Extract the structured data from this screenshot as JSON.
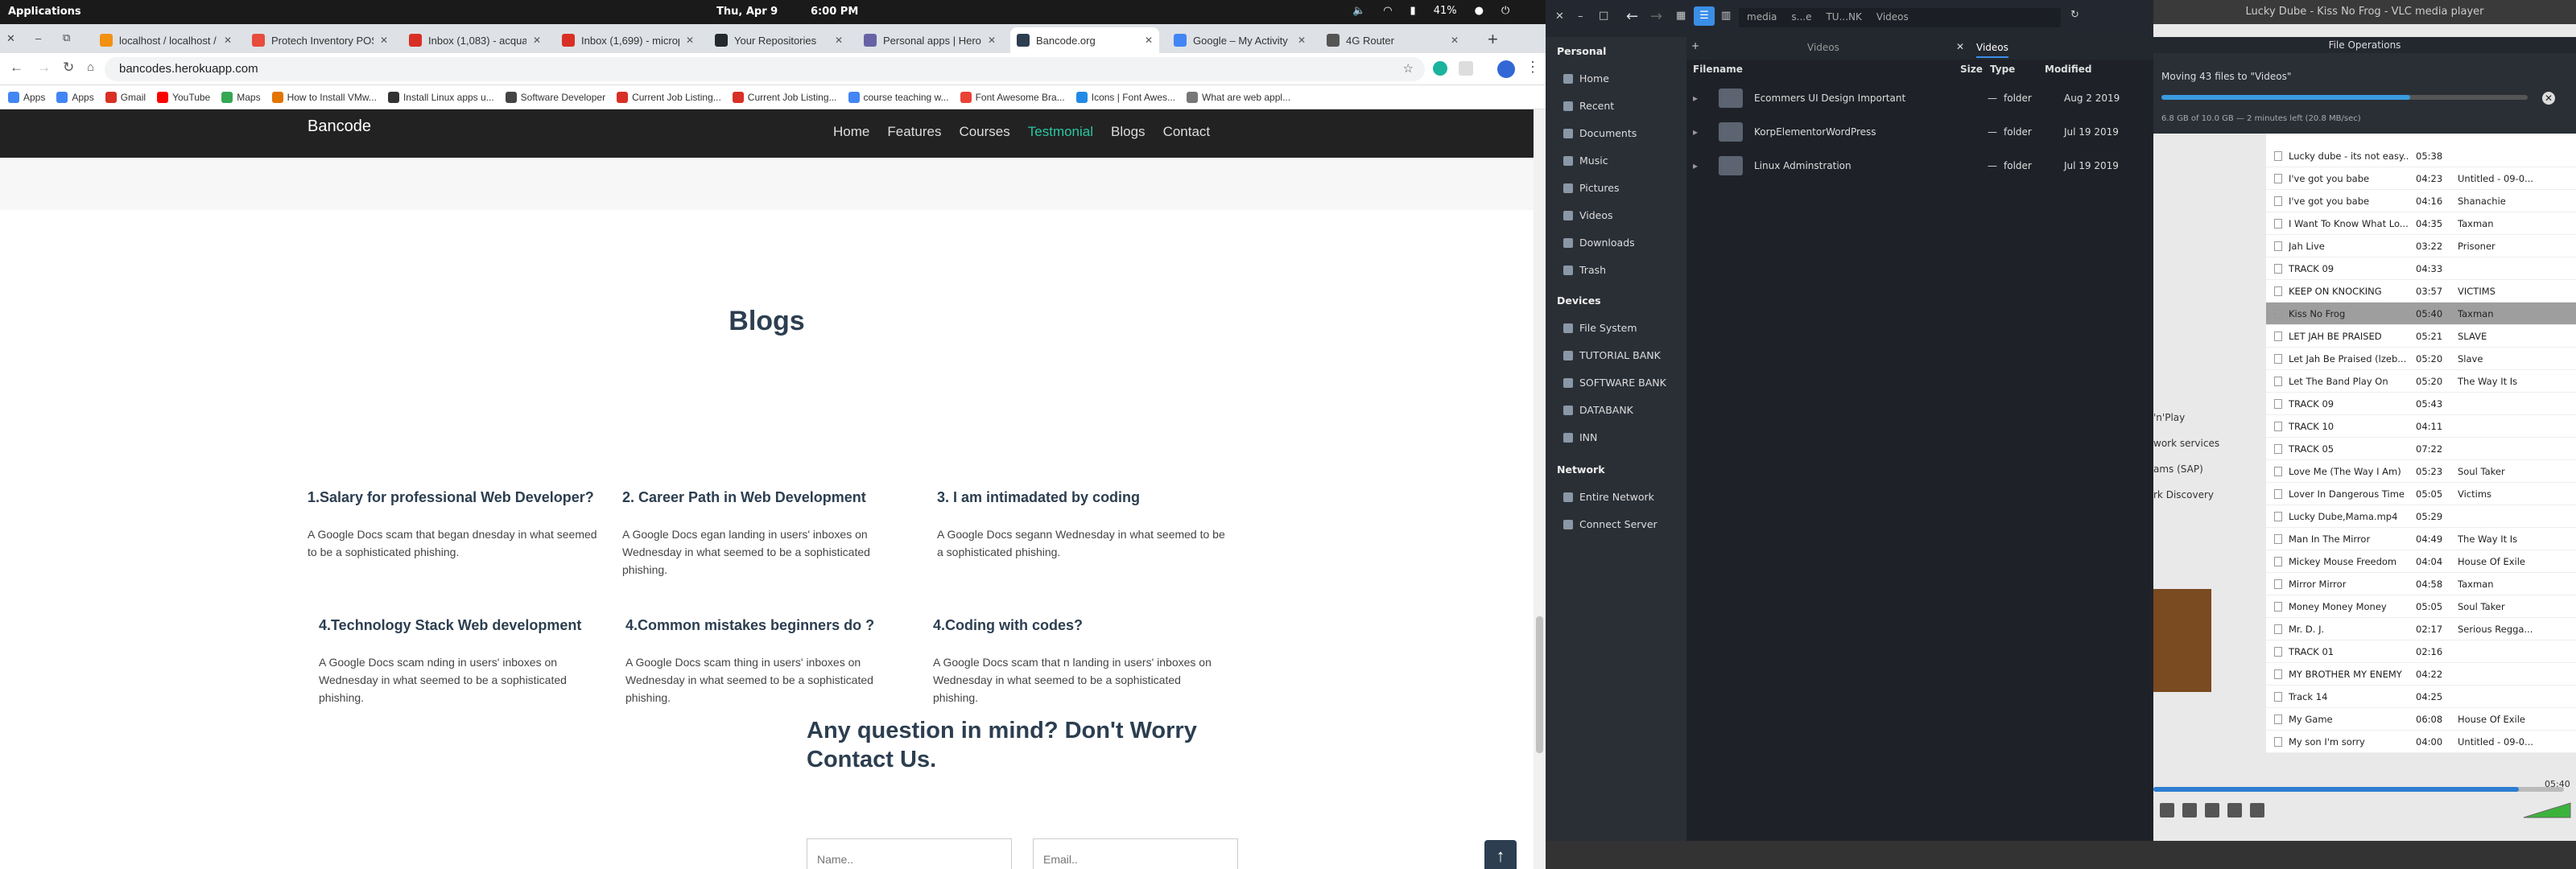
{
  "topbar": {
    "apps": "Applications",
    "clock": "Thu, Apr 9",
    "time": "6:00 PM",
    "battery": "41%"
  },
  "browser": {
    "tabs": [
      {
        "label": "localhost / localhost / d",
        "color": "#f29111"
      },
      {
        "label": "Protech Inventory POS",
        "color": "#e74c3c"
      },
      {
        "label": "Inbox (1,083) - acquah",
        "color": "#d93025"
      },
      {
        "label": "Inbox (1,699) - microp",
        "color": "#d93025"
      },
      {
        "label": "Your Repositories",
        "color": "#24292e"
      },
      {
        "label": "Personal apps | Herok",
        "color": "#6762a6"
      },
      {
        "label": "Bancode.org",
        "color": "#2c3e50"
      },
      {
        "label": "Google – My Activity",
        "color": "#4285f4"
      },
      {
        "label": "4G Router",
        "color": "#555555"
      }
    ],
    "url": "bancodes.herokuapp.com",
    "bookmarks": [
      "Apps",
      "Apps",
      "Gmail",
      "YouTube",
      "Maps",
      "How to Install VMw...",
      "Install Linux apps u...",
      "Software Developer",
      "Current Job Listing...",
      "Current Job Listing...",
      "course teaching w...",
      "Font Awesome Bra...",
      "Icons | Font Awes...",
      "What are web appl..."
    ]
  },
  "site": {
    "brand": "Bancode",
    "nav": [
      "Home",
      "Features",
      "Courses",
      "Testmonial",
      "Blogs",
      "Contact"
    ],
    "blogs_title": "Blogs",
    "posts": [
      {
        "title": "1.Salary for professional Web Developer?",
        "text": "A Google Docs scam that began dnesday in what seemed to be a sophisticated phishing."
      },
      {
        "title": "2. Career Path in Web Development",
        "text": "A Google Docs egan landing in users' inboxes on Wednesday in what seemed to be a sophisticated phishing."
      },
      {
        "title": "3. I am intimadated by coding",
        "text": "A Google Docs segann Wednesday in what seemed to be a sophisticated phishing."
      },
      {
        "title": "4.Technology Stack Web development",
        "text": "A Google Docs scam nding in users' inboxes on Wednesday in what seemed to be a sophisticated phishing."
      },
      {
        "title": "4.Common mistakes beginners do ?",
        "text": "A Google Docs scam thing in users' inboxes on Wednesday in what seemed to be a sophisticated phishing."
      },
      {
        "title": "4.Coding with codes?",
        "text": "A Google Docs scam that n landing in users' inboxes on Wednesday in what seemed to be a sophisticated phishing."
      }
    ],
    "question_title": "Any question in mind? Don't Worry Contact Us.",
    "name_placeholder": "Name..",
    "email_placeholder": "Email.."
  },
  "filemanager": {
    "path": [
      "media",
      "s...e",
      "TU...NK",
      "Videos"
    ],
    "tabs": [
      "Videos",
      "Videos"
    ],
    "personal": "Personal",
    "places": [
      "Home",
      "Recent",
      "Documents",
      "Music",
      "Pictures",
      "Videos",
      "Downloads",
      "Trash"
    ],
    "devices_label": "Devices",
    "devices": [
      "File System",
      "TUTORIAL BANK",
      "SOFTWARE BANK",
      "DATABANK",
      "INN"
    ],
    "network_label": "Network",
    "network": [
      "Entire Network",
      "Connect Server"
    ],
    "columns": [
      "Filename",
      "Size",
      "Type",
      "Modified"
    ],
    "files": [
      {
        "name": "Ecommers UI Design Important",
        "size": "—",
        "type": "folder",
        "modified": "Aug  2 2019"
      },
      {
        "name": "KorpElementorWordPress",
        "size": "—",
        "type": "folder",
        "modified": "Jul 19 2019"
      },
      {
        "name": "Linux Adminstration",
        "size": "—",
        "type": "folder",
        "modified": "Jul 19 2019"
      }
    ]
  },
  "fileops": {
    "header": "File Operations",
    "message": "Moving 43 files to \"Videos\"",
    "progress": 0.68,
    "detail": "6.8 GB of 10.0 GB — 2 minutes left (20.8 MB/sec)"
  },
  "vlc": {
    "title": "Lucky Dube - Kiss No Frog - VLC media player",
    "left_items": [
      "'n'Play",
      "work services",
      "ams (SAP)",
      "rk Discovery"
    ],
    "playlist": [
      {
        "t": "Lucky dube - its not easy...",
        "d": "05:38",
        "a": ""
      },
      {
        "t": "I've got you babe",
        "d": "04:23",
        "a": "Untitled - 09-0..."
      },
      {
        "t": "I've got you babe",
        "d": "04:16",
        "a": "Shanachie"
      },
      {
        "t": "I Want To Know What Lo...",
        "d": "04:35",
        "a": "Taxman"
      },
      {
        "t": "Jah Live",
        "d": "03:22",
        "a": "Prisoner"
      },
      {
        "t": "TRACK 09",
        "d": "04:33",
        "a": ""
      },
      {
        "t": "KEEP ON KNOCKING",
        "d": "03:57",
        "a": "VICTIMS"
      },
      {
        "t": "Kiss No Frog",
        "d": "05:40",
        "a": "Taxman"
      },
      {
        "t": "LET JAH BE PRAISED",
        "d": "05:21",
        "a": "SLAVE"
      },
      {
        "t": "Let Jah Be Praised (lzeb...",
        "d": "05:20",
        "a": "Slave"
      },
      {
        "t": "Let The Band Play On",
        "d": "05:20",
        "a": "The Way It Is"
      },
      {
        "t": "TRACK 09",
        "d": "05:43",
        "a": ""
      },
      {
        "t": "TRACK 10",
        "d": "04:11",
        "a": ""
      },
      {
        "t": "TRACK 05",
        "d": "07:22",
        "a": ""
      },
      {
        "t": "Love Me (The Way I Am)",
        "d": "05:23",
        "a": "Soul Taker"
      },
      {
        "t": "Lover In Dangerous Time",
        "d": "05:05",
        "a": "Victims"
      },
      {
        "t": "Lucky Dube,Mama.mp4",
        "d": "05:29",
        "a": ""
      },
      {
        "t": "Man In The Mirror",
        "d": "04:49",
        "a": "The Way It Is"
      },
      {
        "t": "Mickey Mouse Freedom",
        "d": "04:04",
        "a": "House Of Exile"
      },
      {
        "t": "Mirror Mirror",
        "d": "04:58",
        "a": "Taxman"
      },
      {
        "t": "Money Money Money",
        "d": "05:05",
        "a": "Soul Taker"
      },
      {
        "t": "Mr.  D. J.",
        "d": "02:17",
        "a": "Serious Regga..."
      },
      {
        "t": "TRACK 01",
        "d": "02:16",
        "a": ""
      },
      {
        "t": "MY BROTHER MY ENEMY",
        "d": "04:22",
        "a": ""
      },
      {
        "t": "Track 14",
        "d": "04:25",
        "a": ""
      },
      {
        "t": "My Game",
        "d": "06:08",
        "a": "House Of Exile"
      },
      {
        "t": "My son I'm sorry",
        "d": "04:00",
        "a": "Untitled - 09-0..."
      }
    ],
    "selected_index": 7,
    "time": "05:40",
    "seek": 0.89
  }
}
